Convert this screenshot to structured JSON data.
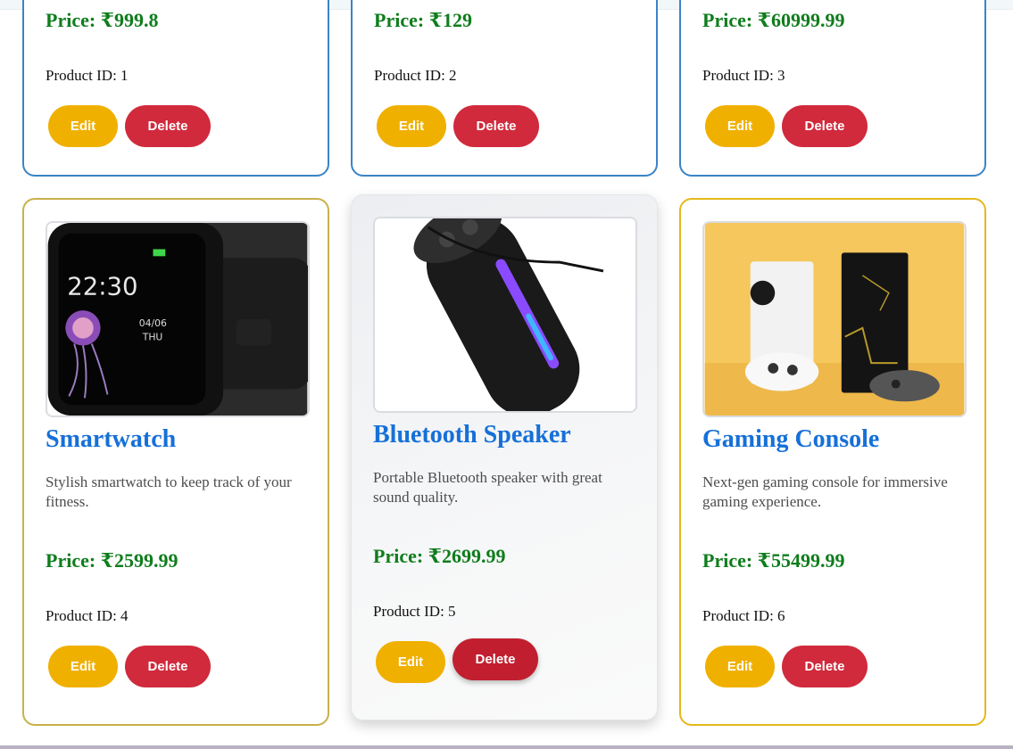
{
  "row1": [
    {
      "price": "Price: ₹999.8",
      "product_id": "Product ID: 1",
      "edit_label": "Edit",
      "delete_label": "Delete"
    },
    {
      "price": "Price: ₹129",
      "product_id": "Product ID: 2",
      "edit_label": "Edit",
      "delete_label": "Delete"
    },
    {
      "price": "Price: ₹60999.99",
      "product_id": "Product ID: 3",
      "edit_label": "Edit",
      "delete_label": "Delete"
    }
  ],
  "row2": [
    {
      "title": "Smartwatch",
      "description": "Stylish smartwatch to keep track of your fitness.",
      "price": "Price: ₹2599.99",
      "product_id": "Product ID: 4",
      "edit_label": "Edit",
      "delete_label": "Delete",
      "image_icon": "smartwatch-image"
    },
    {
      "title": "Bluetooth Speaker",
      "description": "Portable Bluetooth speaker with great sound quality.",
      "price": "Price: ₹2699.99",
      "product_id": "Product ID: 5",
      "edit_label": "Edit",
      "delete_label": "Delete",
      "image_icon": "bluetooth-speaker-image"
    },
    {
      "title": "Gaming Console",
      "description": "Next-gen gaming console for immersive gaming experience.",
      "price": "Price: ₹55499.99",
      "product_id": "Product ID: 6",
      "edit_label": "Edit",
      "delete_label": "Delete",
      "image_icon": "gaming-console-image"
    }
  ],
  "colors": {
    "title": "#1670d8",
    "price": "#0f7d1c",
    "edit_button": "#f0b000",
    "delete_button": "#d02a3c",
    "card_border_blue": "#3a84c6",
    "card_border_gold": "#e6b81a"
  }
}
